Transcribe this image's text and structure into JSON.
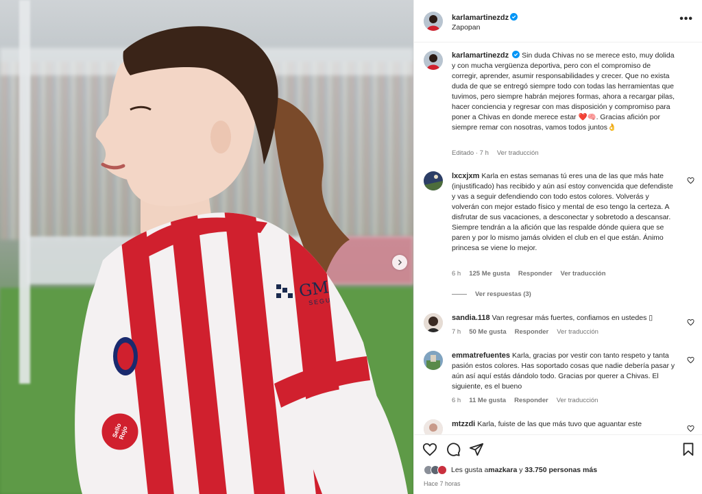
{
  "post": {
    "username": "karlamartinezdz",
    "location": "Zapopan",
    "more_label": "•••",
    "caption": "Sin duda Chivas no se merece esto, muy dolida y con mucha vergüenza deportiva, pero con el compromiso de corregir, aprender, asumir responsabilidades y crecer. Que no exista duda de que se entregó siempre todo con todas las herramientas que tuvimos, pero siempre habrán mejores formas, ahora a recargar pilas, hacer conciencia y regresar con mas disposición y compromiso para poner a Chivas en donde merece estar ❤️🧠. Gracias afición por siempre remar con nosotras, vamos todos juntos👌",
    "caption_meta": {
      "edited": "Editado · 7 h",
      "translate": "Ver traducción"
    }
  },
  "photo": {
    "jersey_sponsor": "GM",
    "jersey_sponsor_sub": "SEGU",
    "badge_text": "Sello Rojo"
  },
  "comments": [
    {
      "username": "lxcxjxm",
      "text": "Karla en estas semanas tú eres una de las que más hate (injustificado) has recibido y aún así estoy convencida que defendiste y vas a seguir defendiendo con todo estos colores. Volverás y volverán con mejor estado físico y mental de eso tengo la certeza. A disfrutar de sus vacaciones, a desconectar y sobretodo a descansar. Siempre tendrán a la afición que las respalde dónde quiera que se paren y por lo mismo jamás olviden el club en el que están. Ánimo princesa se viene lo mejor.",
      "time": "6 h",
      "likes": "125 Me gusta",
      "reply": "Responder",
      "translate": "Ver traducción",
      "view_replies": "Ver respuestas (3)"
    },
    {
      "username": "sandia.118",
      "text": "Van regresar más fuertes, confiamos en ustedes ▯",
      "time": "7 h",
      "likes": "50 Me gusta",
      "reply": "Responder",
      "translate": "Ver traducción"
    },
    {
      "username": "emmatrefuentes",
      "text": "Karla, gracias por vestir con tanto respeto y tanta pasión estos colores. Has soportado cosas que nadie debería pasar y aún así aquí estás dándolo todo. Gracias por querer a Chivas. El siguiente, es el bueno",
      "time": "6 h",
      "likes": "11 Me gusta",
      "reply": "Responder",
      "translate": "Ver traducción"
    },
    {
      "username": "mtzzdi",
      "text": "Karla, fuiste de las que más tuvo que aguantar este"
    }
  ],
  "footer": {
    "likes_prefix": "Les gusta a ",
    "liker": "mazkara",
    "likes_mid": " y ",
    "likes_count": "33.750 personas más",
    "time_ago": "Hace 7 horas"
  },
  "icons": [
    "verified-icon",
    "more-icon",
    "heart-icon",
    "comment-icon",
    "share-icon",
    "bookmark-icon",
    "chevron-right-icon"
  ],
  "colors": {
    "verified": "#0095f6",
    "text": "#262626",
    "meta": "#737373",
    "jersey_red": "#d0202e"
  }
}
